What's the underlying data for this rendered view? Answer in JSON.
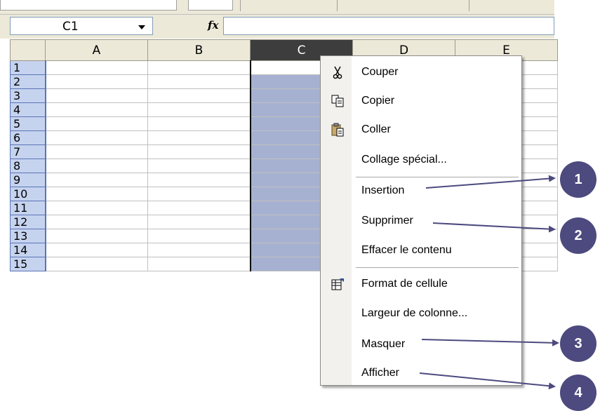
{
  "name_box": {
    "value": "C1"
  },
  "formula_bar": {
    "fx_label": "fx",
    "value": ""
  },
  "columns": [
    "A",
    "B",
    "C",
    "D",
    "E"
  ],
  "selected_column": "C",
  "rows": [
    "1",
    "2",
    "3",
    "4",
    "5",
    "6",
    "7",
    "8",
    "9",
    "10",
    "11",
    "12",
    "13",
    "14",
    "15"
  ],
  "context_menu": {
    "items": [
      {
        "label": "Couper",
        "icon": "scissors-icon"
      },
      {
        "label": "Copier",
        "icon": "copy-icon"
      },
      {
        "label": "Coller",
        "icon": "paste-icon"
      },
      {
        "label": "Collage spécial..."
      },
      {
        "label": "Insertion"
      },
      {
        "label": "Supprimer"
      },
      {
        "label": "Effacer le contenu"
      },
      {
        "label": "Format de cellule",
        "icon": "format-cells-icon"
      },
      {
        "label": "Largeur de colonne..."
      },
      {
        "label": "Masquer"
      },
      {
        "label": "Afficher"
      }
    ]
  },
  "annotations": [
    "1",
    "2",
    "3",
    "4"
  ],
  "colors": {
    "annotation": "#4c4a7e",
    "selection": "#a6b1d2",
    "row_header": "#c6d3ef"
  }
}
